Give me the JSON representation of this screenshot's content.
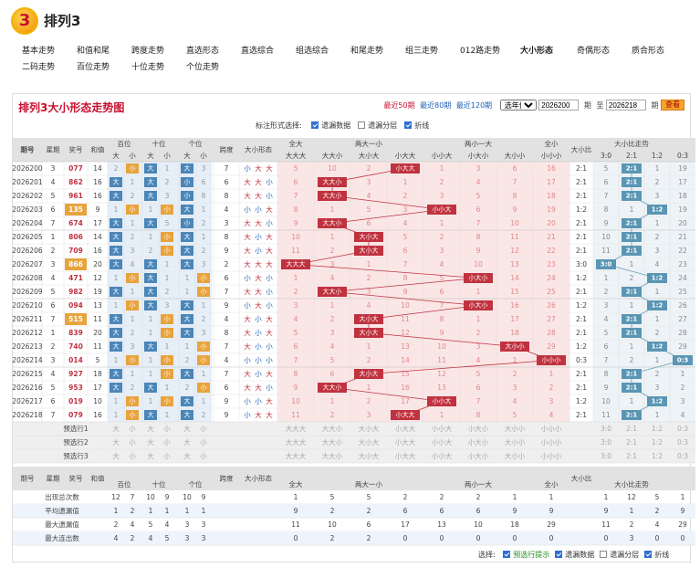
{
  "app": {
    "logo": "3",
    "title": "排列3"
  },
  "nav": [
    [
      "基本走势",
      "和值和尾",
      "跨度走势",
      "直选形态",
      "直选综合",
      "组选综合",
      "和尾走势",
      "组三走势",
      "012路走势",
      "大小形态",
      "奇偶形态",
      "质合形态"
    ],
    [
      "二码走势",
      "百位走势",
      "十位走势",
      "个位走势"
    ]
  ],
  "nav_active": "大小形态",
  "panel": {
    "title": "排列3大小形态走势图",
    "recent": [
      "最近50期",
      "最近80期",
      "最近120期"
    ],
    "year_select": "选年份",
    "from": "2026200",
    "to": "2026218",
    "period_label": "期",
    "to_label": "至",
    "query": "查看"
  },
  "opts": {
    "label": "标注形式选择:",
    "items": [
      [
        "遗漏数据",
        true
      ],
      [
        "遗漏分层",
        false
      ],
      [
        "折线",
        true
      ]
    ]
  },
  "hdr": {
    "issue": "期号",
    "week": "星期",
    "num": "奖号",
    "sum": "和值",
    "bai": "百位",
    "shi": "十位",
    "ge": "个位",
    "big": "大",
    "small": "小",
    "span": "跨度",
    "shape": "大小形态",
    "all_big": "全大",
    "all_big_sub": "大大大",
    "two_big": "两大一小",
    "two_big_sub": [
      "大大小",
      "大小大",
      "小大大"
    ],
    "two_small": "两小一大",
    "two_small_sub": [
      "小小大",
      "小大小",
      "大小小"
    ],
    "all_small": "全小",
    "all_small_sub": "小小小",
    "ratio": "大小比",
    "ratio_trend": "大小比走势",
    "ratio_sub": [
      "3:0",
      "2:1",
      "1:2",
      "0:3"
    ]
  },
  "rows": [
    [
      "2026200",
      "3",
      "077",
      "14"
    ],
    [
      "2026201",
      "4",
      "862",
      "16"
    ],
    [
      "2026202",
      "5",
      "961",
      "16"
    ],
    [
      "2026203",
      "6",
      "135",
      "9"
    ],
    [
      "2026204",
      "7",
      "674",
      "17"
    ],
    [
      "2026205",
      "1",
      "806",
      "14"
    ],
    [
      "2026206",
      "2",
      "709",
      "16"
    ],
    [
      "2026207",
      "3",
      "866",
      "20"
    ],
    [
      "2026208",
      "4",
      "471",
      "12"
    ],
    [
      "2026209",
      "5",
      "982",
      "19"
    ],
    [
      "2026210",
      "6",
      "094",
      "13"
    ],
    [
      "2026211",
      "7",
      "515",
      "11"
    ],
    [
      "2026212",
      "1",
      "839",
      "20"
    ],
    [
      "2026213",
      "2",
      "740",
      "11"
    ],
    [
      "2026214",
      "3",
      "014",
      "5"
    ],
    [
      "2026215",
      "4",
      "927",
      "18"
    ],
    [
      "2026216",
      "5",
      "953",
      "17"
    ],
    [
      "2026217",
      "6",
      "019",
      "10"
    ],
    [
      "2026218",
      "7",
      "079",
      "16"
    ]
  ],
  "pos_cells": [
    [
      [
        "2",
        0
      ],
      [
        "小",
        1
      ],
      [
        "大",
        1
      ],
      [
        "1",
        0
      ],
      [
        "大",
        1
      ],
      [
        "3",
        0
      ]
    ],
    [
      [
        "大",
        1
      ],
      [
        "1",
        0
      ],
      [
        "大",
        1
      ],
      [
        "2",
        0
      ],
      [
        "小",
        1
      ],
      [
        "6",
        0
      ]
    ],
    [
      [
        "大",
        1
      ],
      [
        "2",
        0
      ],
      [
        "大",
        1
      ],
      [
        "3",
        0
      ],
      [
        "小",
        1
      ],
      [
        "8",
        0
      ]
    ],
    [
      [
        "1",
        0
      ],
      [
        "小",
        1
      ],
      [
        "1",
        0
      ],
      [
        "小",
        1
      ],
      [
        "大",
        1
      ],
      [
        "1",
        0
      ]
    ],
    [
      [
        "大",
        1
      ],
      [
        "1",
        0
      ],
      [
        "大",
        1
      ],
      [
        "5",
        0
      ],
      [
        "小",
        1
      ],
      [
        "2",
        0
      ]
    ],
    [
      [
        "大",
        1
      ],
      [
        "2",
        0
      ],
      [
        "1",
        0
      ],
      [
        "小",
        1
      ],
      [
        "大",
        1
      ],
      [
        "1",
        0
      ]
    ],
    [
      [
        "大",
        1
      ],
      [
        "3",
        0
      ],
      [
        "2",
        0
      ],
      [
        "小",
        1
      ],
      [
        "大",
        1
      ],
      [
        "2",
        0
      ]
    ],
    [
      [
        "大",
        1
      ],
      [
        "4",
        0
      ],
      [
        "大",
        1
      ],
      [
        "1",
        0
      ],
      [
        "大",
        1
      ],
      [
        "3",
        0
      ]
    ],
    [
      [
        "1",
        0
      ],
      [
        "小",
        1
      ],
      [
        "大",
        1
      ],
      [
        "1",
        0
      ],
      [
        "1",
        0
      ],
      [
        "小",
        1
      ]
    ],
    [
      [
        "大",
        1
      ],
      [
        "1",
        0
      ],
      [
        "大",
        1
      ],
      [
        "2",
        0
      ],
      [
        "1",
        0
      ],
      [
        "小",
        1
      ]
    ],
    [
      [
        "1",
        0
      ],
      [
        "小",
        1
      ],
      [
        "大",
        1
      ],
      [
        "3",
        0
      ],
      [
        "大",
        1
      ],
      [
        "1",
        0
      ]
    ],
    [
      [
        "大",
        1
      ],
      [
        "1",
        0
      ],
      [
        "1",
        0
      ],
      [
        "小",
        1
      ],
      [
        "大",
        1
      ],
      [
        "2",
        0
      ]
    ],
    [
      [
        "大",
        1
      ],
      [
        "2",
        0
      ],
      [
        "1",
        0
      ],
      [
        "小",
        1
      ],
      [
        "大",
        1
      ],
      [
        "3",
        0
      ]
    ],
    [
      [
        "大",
        1
      ],
      [
        "3",
        0
      ],
      [
        "大",
        1
      ],
      [
        "1",
        0
      ],
      [
        "1",
        0
      ],
      [
        "小",
        1
      ]
    ],
    [
      [
        "1",
        0
      ],
      [
        "小",
        1
      ],
      [
        "1",
        0
      ],
      [
        "小",
        1
      ],
      [
        "2",
        0
      ],
      [
        "小",
        1
      ]
    ],
    [
      [
        "大",
        1
      ],
      [
        "1",
        0
      ],
      [
        "1",
        0
      ],
      [
        "小",
        1
      ],
      [
        "大",
        1
      ],
      [
        "1",
        0
      ]
    ],
    [
      [
        "大",
        1
      ],
      [
        "2",
        0
      ],
      [
        "大",
        1
      ],
      [
        "1",
        0
      ],
      [
        "2",
        0
      ],
      [
        "小",
        1
      ]
    ],
    [
      [
        "1",
        0
      ],
      [
        "小",
        1
      ],
      [
        "1",
        0
      ],
      [
        "小",
        1
      ],
      [
        "大",
        1
      ],
      [
        "1",
        0
      ]
    ],
    [
      [
        "1",
        0
      ],
      [
        "小",
        1
      ],
      [
        "大",
        1
      ],
      [
        "1",
        0
      ],
      [
        "大",
        1
      ],
      [
        "2",
        0
      ]
    ]
  ],
  "spans": [
    "7",
    "6",
    "8",
    "4",
    "3",
    "8",
    "9",
    "2",
    "6",
    "7",
    "9",
    "4",
    "8",
    "7",
    "4",
    "7",
    "6",
    "9",
    "9"
  ],
  "shapes": [
    "小大大",
    "大大小",
    "大大小",
    "小小大",
    "大大小",
    "大小大",
    "大小大",
    "大大大",
    "小大小",
    "大大小",
    "小大小",
    "大小大",
    "大小大",
    "大小小",
    "小小小",
    "大小大",
    "大大小",
    "小小大",
    "小大大"
  ],
  "shape_cells": [
    [
      "5",
      "10",
      "2",
      "小大大",
      "1",
      "3",
      "6",
      "16"
    ],
    [
      "6",
      "大大小",
      "3",
      "1",
      "2",
      "4",
      "7",
      "17"
    ],
    [
      "7",
      "大大小",
      "4",
      "2",
      "3",
      "5",
      "8",
      "18"
    ],
    [
      "8",
      "1",
      "5",
      "3",
      "小小大",
      "6",
      "9",
      "19"
    ],
    [
      "9",
      "大大小",
      "6",
      "4",
      "1",
      "7",
      "10",
      "20"
    ],
    [
      "10",
      "1",
      "大小大",
      "5",
      "2",
      "8",
      "11",
      "21"
    ],
    [
      "11",
      "2",
      "大小大",
      "6",
      "3",
      "9",
      "12",
      "22"
    ],
    [
      "大大大",
      "3",
      "1",
      "7",
      "4",
      "10",
      "13",
      "23"
    ],
    [
      "1",
      "4",
      "2",
      "8",
      "5",
      "小大小",
      "14",
      "24"
    ],
    [
      "2",
      "大大小",
      "3",
      "9",
      "6",
      "1",
      "15",
      "25"
    ],
    [
      "3",
      "1",
      "4",
      "10",
      "7",
      "小大小",
      "16",
      "26"
    ],
    [
      "4",
      "2",
      "大小大",
      "11",
      "8",
      "1",
      "17",
      "27"
    ],
    [
      "5",
      "3",
      "大小大",
      "12",
      "9",
      "2",
      "18",
      "28"
    ],
    [
      "6",
      "4",
      "1",
      "13",
      "10",
      "3",
      "大小小",
      "29"
    ],
    [
      "7",
      "5",
      "2",
      "14",
      "11",
      "4",
      "1",
      "小小小"
    ],
    [
      "8",
      "6",
      "大小大",
      "15",
      "12",
      "5",
      "2",
      "1"
    ],
    [
      "9",
      "大大小",
      "1",
      "16",
      "13",
      "6",
      "3",
      "2"
    ],
    [
      "10",
      "1",
      "2",
      "17",
      "小小大",
      "7",
      "4",
      "3"
    ],
    [
      "11",
      "2",
      "3",
      "小大大",
      "1",
      "8",
      "5",
      "4"
    ]
  ],
  "ratios": [
    "2:1",
    "2:1",
    "2:1",
    "1:2",
    "2:1",
    "2:1",
    "2:1",
    "3:0",
    "1:2",
    "2:1",
    "1:2",
    "2:1",
    "2:1",
    "1:2",
    "0:3",
    "2:1",
    "2:1",
    "1:2",
    "2:1"
  ],
  "ratio_cells": [
    [
      "5",
      "2:1",
      "1",
      "19"
    ],
    [
      "6",
      "2:1",
      "2",
      "17"
    ],
    [
      "7",
      "2:1",
      "3",
      "18"
    ],
    [
      "8",
      "1",
      "1:2",
      "19"
    ],
    [
      "9",
      "2:1",
      "1",
      "20"
    ],
    [
      "10",
      "2:1",
      "2",
      "21"
    ],
    [
      "11",
      "2:1",
      "3",
      "22"
    ],
    [
      "3:0",
      "1",
      "4",
      "23"
    ],
    [
      "1",
      "2",
      "1:2",
      "24"
    ],
    [
      "2",
      "2:1",
      "1",
      "25"
    ],
    [
      "3",
      "1",
      "1:2",
      "26"
    ],
    [
      "4",
      "2:1",
      "1",
      "27"
    ],
    [
      "5",
      "2:1",
      "2",
      "28"
    ],
    [
      "6",
      "1",
      "1:2",
      "29"
    ],
    [
      "7",
      "2",
      "1",
      "0:3"
    ],
    [
      "8",
      "2:1",
      "2",
      "1"
    ],
    [
      "9",
      "2:1",
      "3",
      "2"
    ],
    [
      "10",
      "1",
      "1:2",
      "3"
    ],
    [
      "11",
      "2:1",
      "1",
      "4"
    ]
  ],
  "pre_rows": [
    "预选行1",
    "预选行2",
    "预选行3"
  ],
  "pre_labels": {
    "pos": [
      "大",
      "小",
      "大",
      "小",
      "大",
      "小"
    ],
    "shapes": [
      "大大大",
      "大大小",
      "大小大",
      "小大大",
      "小小大",
      "小大小",
      "大小小",
      "小小小"
    ],
    "ratios": [
      "3:0",
      "2:1",
      "1:2",
      "0:3"
    ]
  },
  "stats": [
    {
      "label": "出现总次数",
      "pos": [
        "12",
        "7",
        "10",
        "9",
        "10",
        "9"
      ],
      "shape": [
        "1",
        "5",
        "5",
        "2",
        "2",
        "2",
        "1",
        "1"
      ],
      "ratio": [
        "1",
        "12",
        "5",
        "1"
      ]
    },
    {
      "label": "平均遗漏值",
      "pos": [
        "1",
        "2",
        "1",
        "1",
        "1",
        "1"
      ],
      "shape": [
        "9",
        "2",
        "2",
        "6",
        "6",
        "6",
        "9",
        "9"
      ],
      "ratio": [
        "9",
        "1",
        "2",
        "9"
      ]
    },
    {
      "label": "最大遗漏值",
      "pos": [
        "2",
        "4",
        "5",
        "4",
        "3",
        "3"
      ],
      "shape": [
        "11",
        "10",
        "6",
        "17",
        "13",
        "10",
        "18",
        "29"
      ],
      "ratio": [
        "11",
        "2",
        "4",
        "29"
      ]
    },
    {
      "label": "最大连出数",
      "pos": [
        "4",
        "2",
        "4",
        "5",
        "3",
        "3"
      ],
      "shape": [
        "0",
        "2",
        "2",
        "0",
        "0",
        "0",
        "0",
        "0"
      ],
      "ratio": [
        "0",
        "3",
        "0",
        "0"
      ]
    }
  ],
  "bottom": {
    "label": "选择:",
    "items": [
      [
        "预选行提示",
        true,
        "#1b8a1b"
      ],
      [
        "遗漏数据",
        true,
        "#333"
      ],
      [
        "遗漏分层",
        false,
        "#333"
      ],
      [
        "折线",
        true,
        "#333"
      ]
    ]
  },
  "colors": {
    "hit_blue": "#4a86b8",
    "hit_yellow": "#e8a33c",
    "hit_red": "#c0323f",
    "ratio_teal": "#5a96b4",
    "line": "#c0323f",
    "header": "#e2e2e2",
    "pos_bg": "#e6eef8",
    "shape_bg": "#fbe6e6",
    "ratio_bg": "#eef3f7"
  }
}
